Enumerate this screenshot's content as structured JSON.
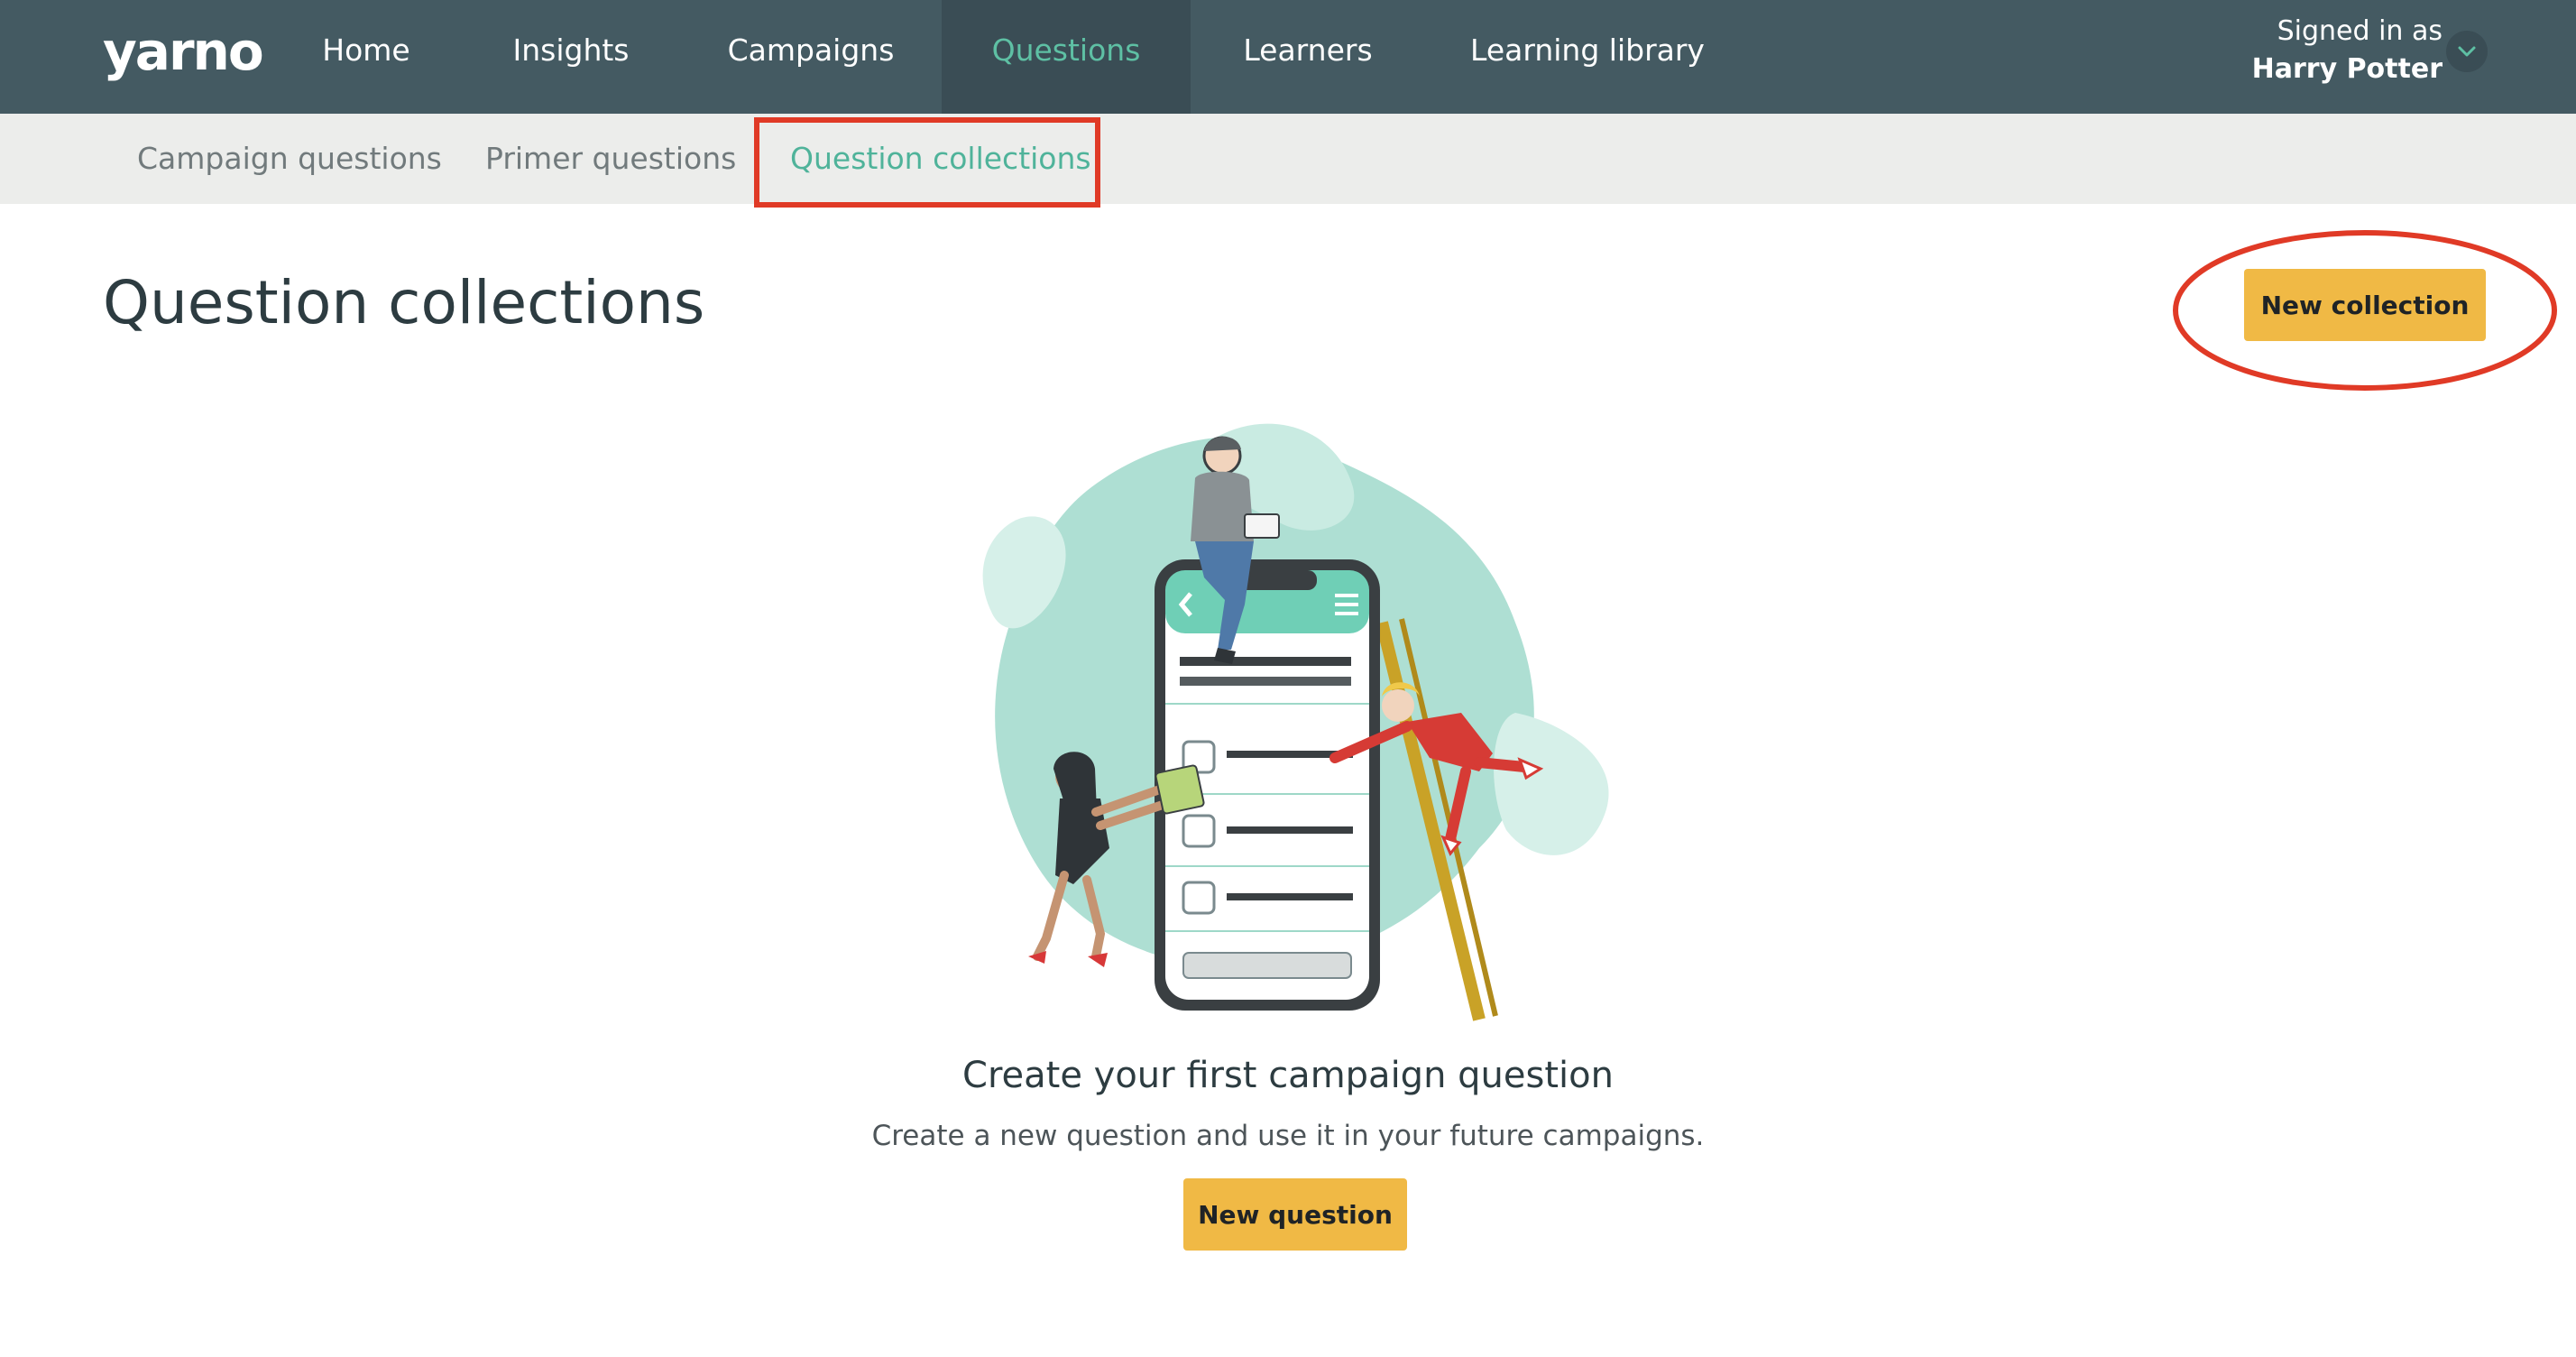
{
  "app": {
    "logo": "yarno"
  },
  "nav": {
    "items": [
      {
        "label": "Home"
      },
      {
        "label": "Insights"
      },
      {
        "label": "Campaigns"
      },
      {
        "label": "Questions",
        "active": true
      },
      {
        "label": "Learners"
      },
      {
        "label": "Learning library"
      }
    ],
    "user": {
      "signed_in_label": "Signed in as",
      "name": "Harry Potter"
    }
  },
  "subnav": {
    "items": [
      {
        "label": "Campaign questions"
      },
      {
        "label": "Primer questions"
      },
      {
        "label": "Question collections",
        "active": true
      }
    ]
  },
  "main": {
    "title": "Question collections",
    "new_collection_label": "New collection",
    "empty_state": {
      "title": "Create your first campaign question",
      "description": "Create a new question and use it in your future campaigns.",
      "button_label": "New question"
    }
  },
  "colors": {
    "nav_bg": "#445a62",
    "accent_teal": "#5ec0a4",
    "button_yellow": "#f0b945",
    "annotation_red": "#e03a26"
  }
}
